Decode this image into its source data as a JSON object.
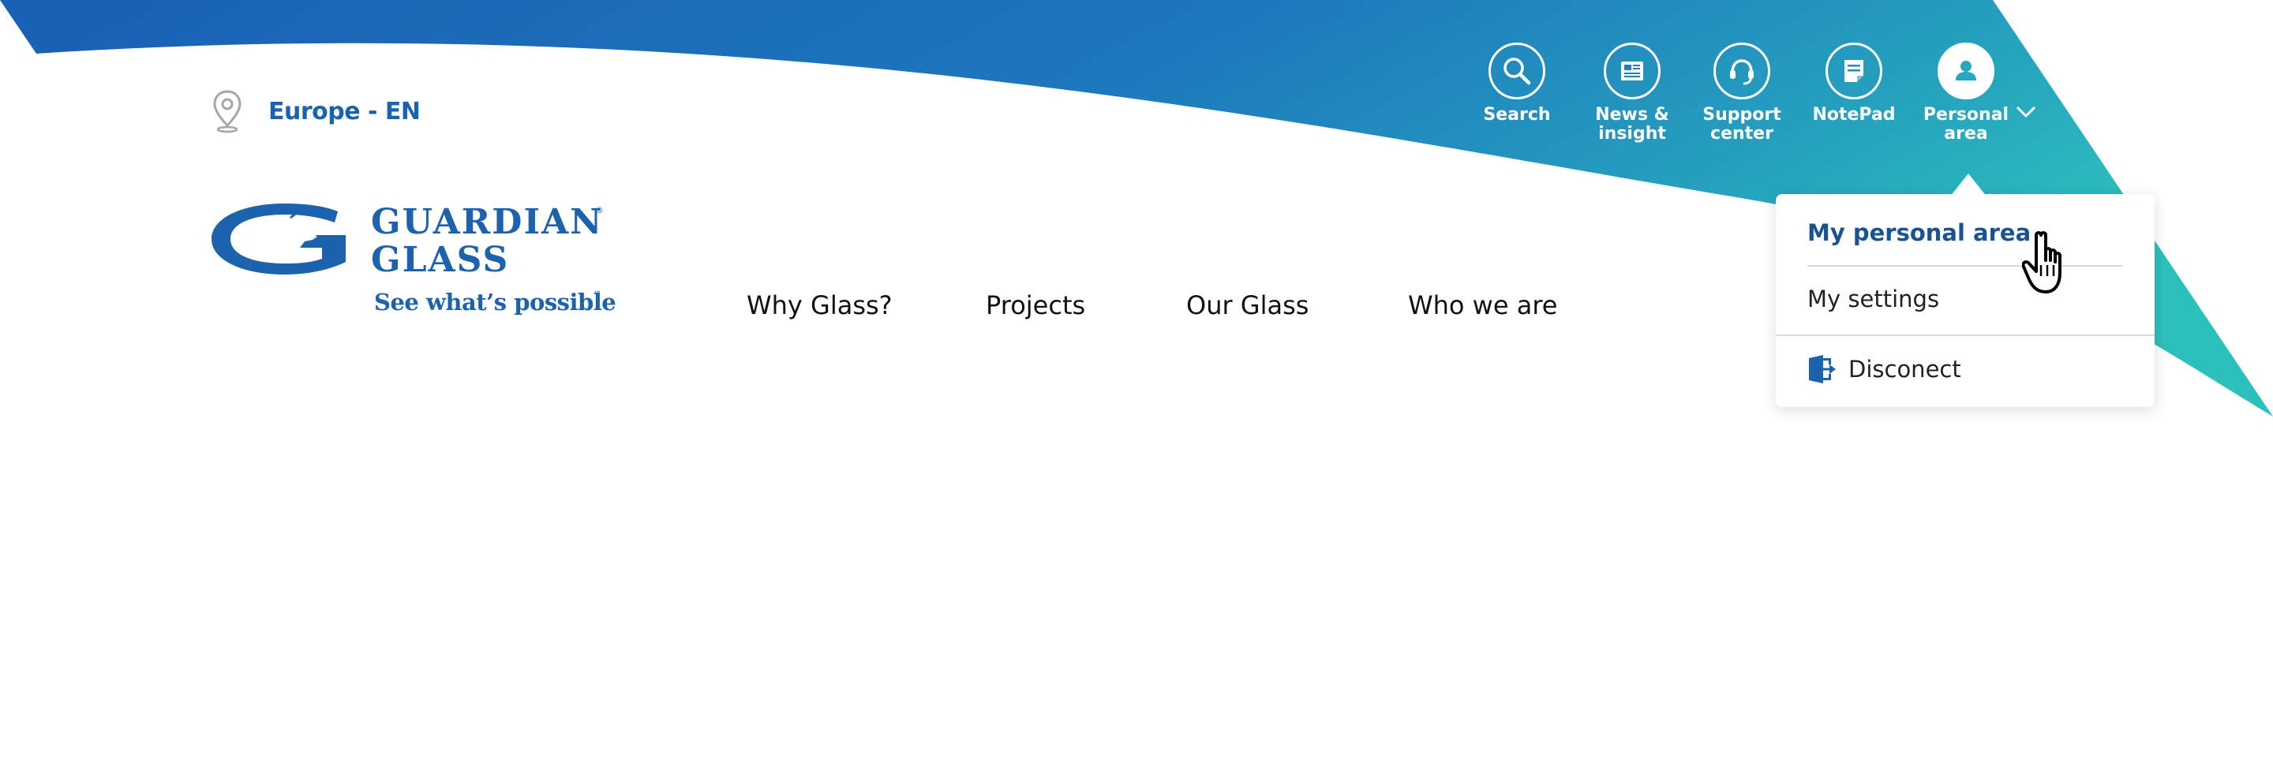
{
  "region": {
    "label": "Europe - EN",
    "icon": "map-pin-icon"
  },
  "brand": {
    "name_line1": "GUARDIAN",
    "name_line2": "GLASS",
    "registered_mark": "®",
    "tagline": "See what’s possible",
    "trademark_mark": "™",
    "logo_icon": "guardian-glass-logo-icon"
  },
  "nav": {
    "items": [
      {
        "label": "Why Glass?"
      },
      {
        "label": "Projects"
      },
      {
        "label": "Our Glass"
      },
      {
        "label": "Who we are"
      }
    ]
  },
  "utility": {
    "search": {
      "label": "Search",
      "icon": "search-icon"
    },
    "news": {
      "label": "News &\ninsight",
      "icon": "newspaper-icon"
    },
    "support": {
      "label": "Support\ncenter",
      "icon": "headset-icon"
    },
    "notepad": {
      "label": "NotePad",
      "icon": "notepad-icon"
    },
    "personal": {
      "label": "Personal\narea",
      "icon": "user-icon",
      "dropdown_icon": "chevron-down-icon"
    }
  },
  "dropdown": {
    "items": [
      {
        "label": "My personal area",
        "active": true
      },
      {
        "label": "My settings"
      },
      {
        "label": "Disconect",
        "icon": "logout-icon"
      }
    ]
  },
  "colors": {
    "brand_blue": "#1c62ad",
    "gradient_start": "#1a5fb4",
    "gradient_end": "#2bbcbc",
    "active_link": "#1a5394"
  }
}
